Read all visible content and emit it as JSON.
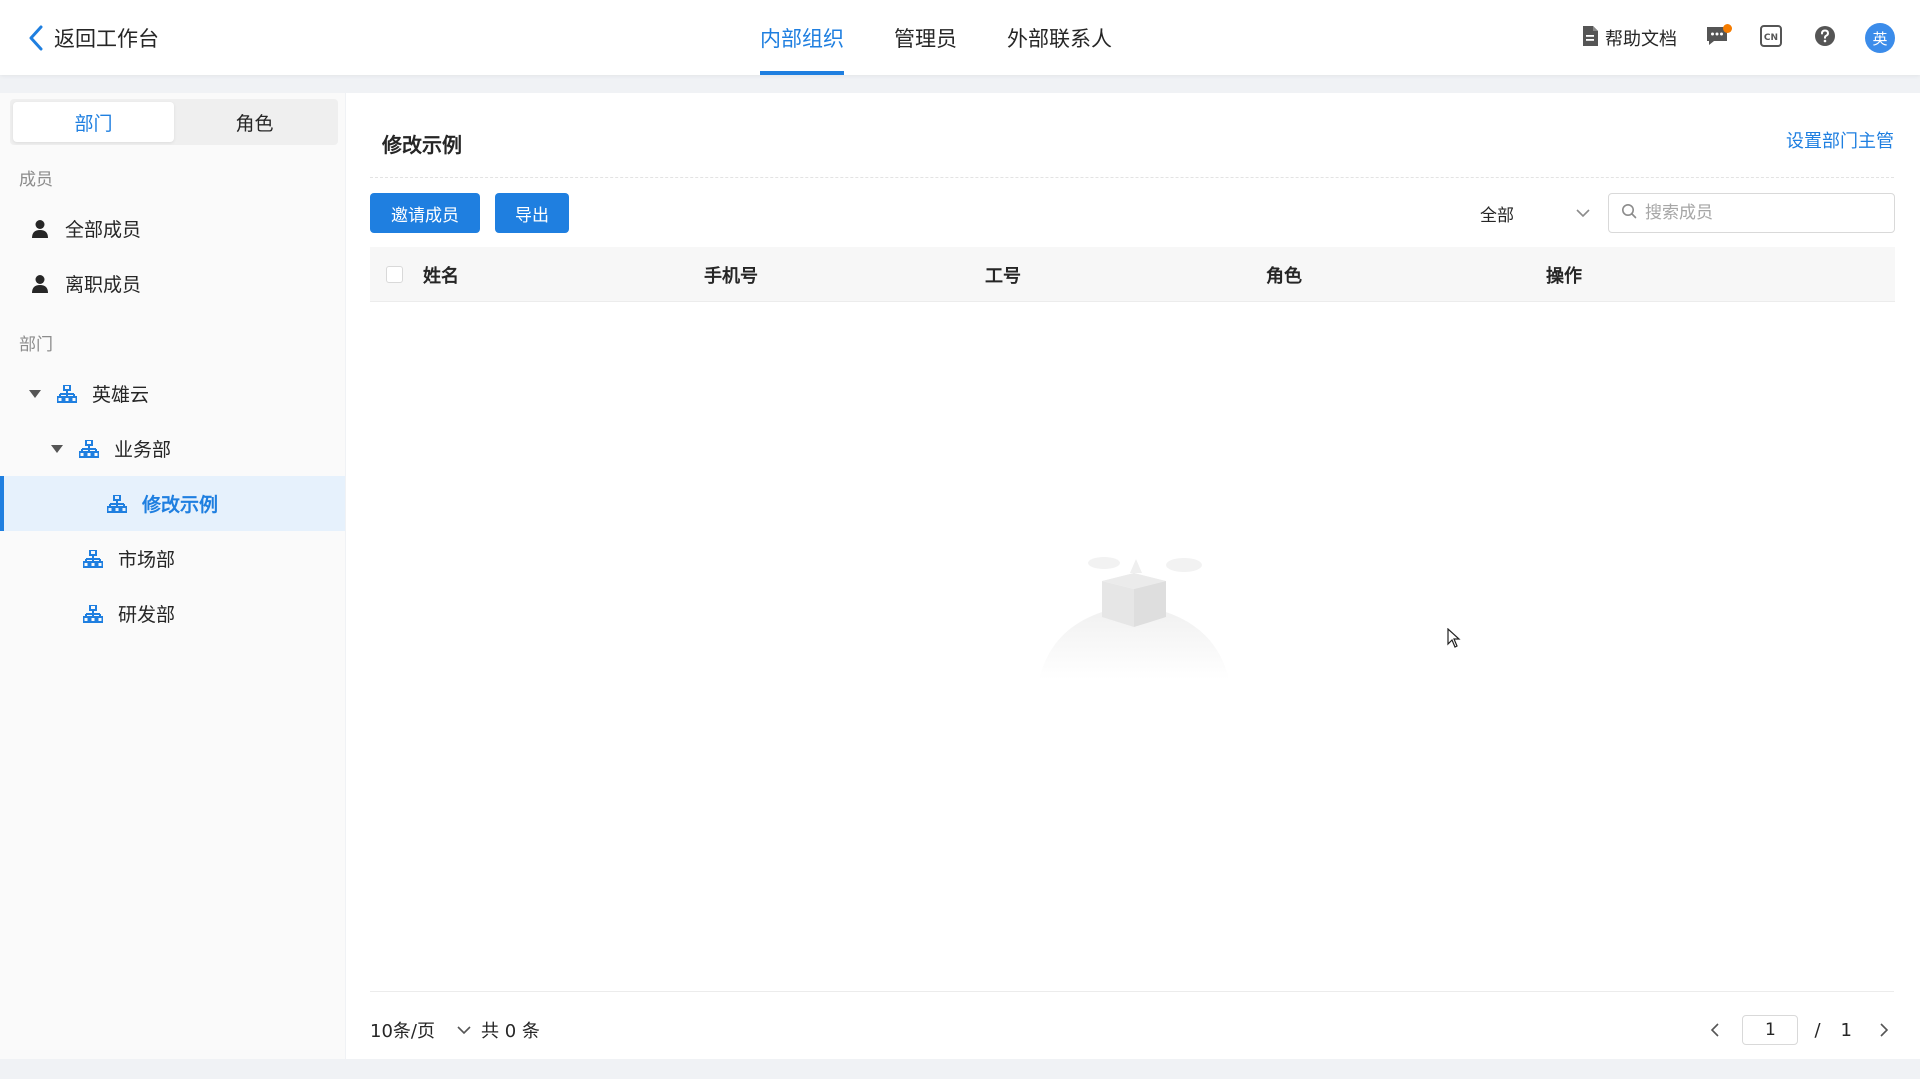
{
  "header": {
    "back_label": "返回工作台",
    "tabs": [
      {
        "label": "内部组织",
        "active": true
      },
      {
        "label": "管理员",
        "active": false
      },
      {
        "label": "外部联系人",
        "active": false
      }
    ],
    "help_label": "帮助文档",
    "lang_icon_text": "CN",
    "avatar_text": "英"
  },
  "sidebar": {
    "segments": [
      "部门",
      "角色"
    ],
    "members_section": "成员",
    "member_items": [
      "全部成员",
      "离职成员"
    ],
    "dept_section": "部门",
    "tree": [
      {
        "label": "英雄云",
        "level": 0,
        "expanded": true
      },
      {
        "label": "业务部",
        "level": 1,
        "expanded": true
      },
      {
        "label": "修改示例",
        "level": 2,
        "selected": true
      },
      {
        "label": "市场部",
        "level": 1
      },
      {
        "label": "研发部",
        "level": 1
      }
    ]
  },
  "main": {
    "title": "修改示例",
    "set_manager_label": "设置部门主管",
    "invite_label": "邀请成员",
    "export_label": "导出",
    "filter_value": "全部",
    "search_placeholder": "搜索成员",
    "columns": [
      "姓名",
      "手机号",
      "工号",
      "角色",
      "操作"
    ],
    "footer": {
      "page_size": "10条/页",
      "total_text": "共 0 条",
      "current_page": "1",
      "slash": "/",
      "total_pages": "1"
    }
  },
  "colors": {
    "accent": "#1f7fe0",
    "selected_bg": "#e6f1fc",
    "notification_dot": "#f57c00"
  }
}
